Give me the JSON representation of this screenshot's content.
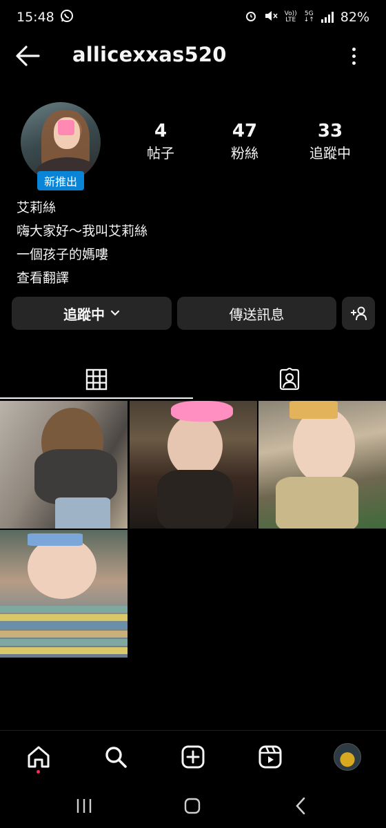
{
  "status_bar": {
    "time": "15:48",
    "network_top": "Vo))",
    "network_bottom": "LTE",
    "net_gen": "5G",
    "battery": "82%"
  },
  "header": {
    "username": "allicexxas520"
  },
  "profile": {
    "new_badge": "新推出",
    "stats": {
      "posts_count": "4",
      "posts_label": "帖子",
      "followers_count": "47",
      "followers_label": "粉絲",
      "following_count": "33",
      "following_label": "追蹤中"
    },
    "bio": {
      "name": "艾莉絲",
      "line1": "嗨大家好〜我叫艾莉絲",
      "line2": "一個孩子的媽嘍",
      "translate": "查看翻譯"
    }
  },
  "actions": {
    "following_label": "追蹤中",
    "message_label": "傳送訊息"
  },
  "icons": {
    "back": "arrow-left-icon",
    "more": "more-vertical-icon",
    "grid": "grid-icon",
    "tagged": "tagged-person-icon",
    "home": "home-icon",
    "search": "search-icon",
    "create": "plus-square-icon",
    "reels": "reels-icon",
    "add_person": "add-person-icon"
  },
  "colors": {
    "background": "#000000",
    "button": "#262626",
    "badge": "#0a84d6",
    "notification_dot": "#ff2d55"
  },
  "posts": [
    {
      "id": "post-1"
    },
    {
      "id": "post-2"
    },
    {
      "id": "post-3"
    },
    {
      "id": "post-4"
    }
  ]
}
